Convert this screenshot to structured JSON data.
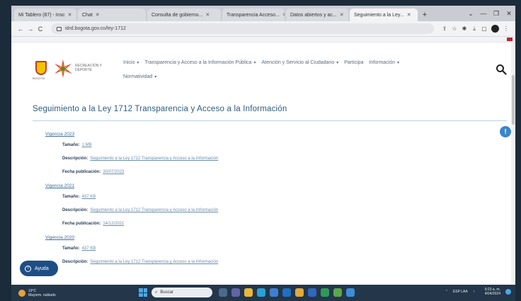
{
  "browser": {
    "tabs": [
      {
        "label": "Mi Tablero (87) - Insc",
        "active": false
      },
      {
        "label": "Chat",
        "active": false
      },
      {
        "label": "Consulta de gobierno...",
        "active": false
      },
      {
        "label": "Transparencia Acceso...",
        "active": false
      },
      {
        "label": "Datos abiertos y ac...",
        "active": false
      },
      {
        "label": "Seguimiento a la Ley...",
        "active": true
      }
    ],
    "new_tab": "+",
    "window_controls": [
      "⌄",
      "—",
      "❐",
      "✕"
    ],
    "url": "idrd.bogota.gov.co/ley-1712",
    "nav_back": "←",
    "nav_forward": "→",
    "nav_reload": "C"
  },
  "site": {
    "logo_caption": "BOGOTÁ",
    "logo_text": "RECREACIÓN Y DEPORTE",
    "nav": {
      "row1": [
        "Inicio",
        "Transparencia y Acceso a la Información Pública",
        "Atención y Servicio al Ciudadano",
        "Participa",
        "Información"
      ],
      "row2": [
        "Normatividad"
      ]
    }
  },
  "page": {
    "title": "Seguimiento  a la Ley 1712 Transparencia y Acceso a la Información",
    "labels": {
      "size": "Tamaño:",
      "description": "Descripción:",
      "published": "Fecha publicación:"
    },
    "documents": [
      {
        "title": "Vigencia 2023",
        "size": "1 MB",
        "description": "Seguimiento a la Ley 1712 Transparencia y Acceso a la Información",
        "published": "30/07/2023"
      },
      {
        "title": "Vigencia 2021",
        "size": "437 KB",
        "description": "Seguimiento a la Ley 1712 Transparencia y Acceso a la Información",
        "published": "14/12/2021"
      },
      {
        "title": "Vigencia 2020",
        "size": "437 KB",
        "description": "Seguimiento a la Ley 1712 Transparencia y Acceso a la Información",
        "published": ""
      }
    ],
    "help_button": "Ayuda"
  },
  "taskbar": {
    "weather_temp": "19°C",
    "weather_desc": "Mayorm. nublado",
    "search_placeholder": "Buscar",
    "lang": "ESP LAA",
    "time": "9:23 a. m.",
    "date": "4/04/2024"
  },
  "colors": {
    "title": "#2c5a7a",
    "link": "#3f6f95",
    "help": "#1e4e86",
    "taskbar": "#23364a"
  }
}
